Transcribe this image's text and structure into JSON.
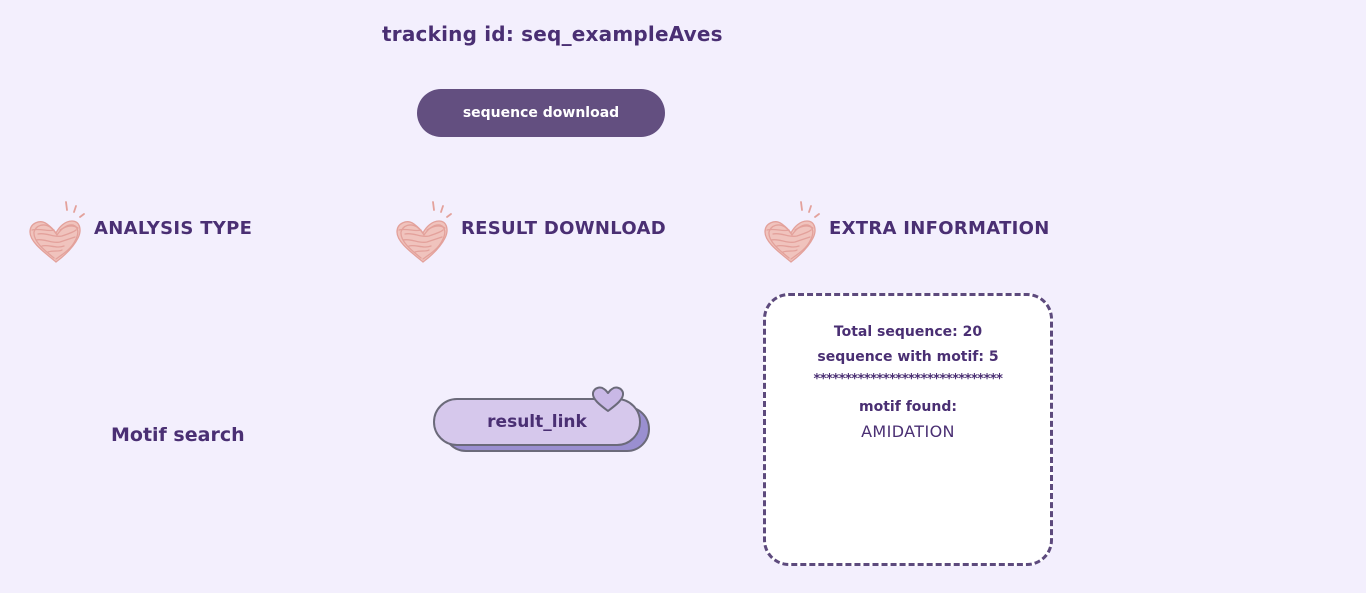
{
  "header": {
    "tracking_label": "tracking id: seq_exampleAves",
    "sequence_download_label": "sequence download"
  },
  "sections": {
    "analysis_type": {
      "title": "ANALYSIS TYPE",
      "value": "Motif search"
    },
    "result_download": {
      "title": "RESULT DOWNLOAD",
      "link_label": "result_link"
    },
    "extra_information": {
      "title": "EXTRA INFORMATION",
      "total_sequence": "Total sequence: 20",
      "sequence_with_motif": "sequence with motif: 5",
      "separator": "******************************",
      "motif_found_label": "motif found:",
      "motif_found_value": "AMIDATION"
    }
  },
  "icons": {
    "section_icon": "heart-doodle-icon",
    "link_badge_icon": "heart-icon"
  },
  "colors": {
    "background": "#f3effd",
    "text": "#4a2f73",
    "button": "#634f80",
    "link_pill": "#d6c8ec",
    "link_shadow": "#9a8fd0",
    "heart": "#e8a9a4"
  }
}
